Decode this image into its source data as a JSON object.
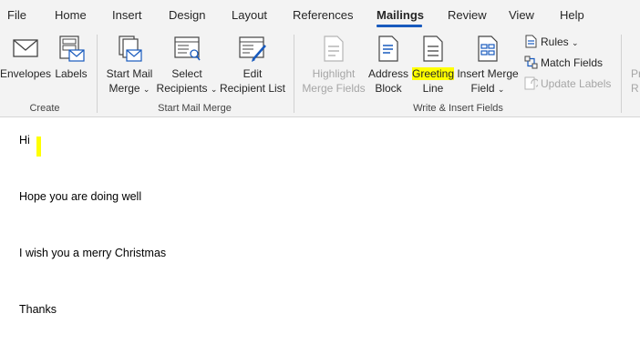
{
  "tabs": [
    "File",
    "Home",
    "Insert",
    "Design",
    "Layout",
    "References",
    "Mailings",
    "Review",
    "View",
    "Help"
  ],
  "active_tab": "Mailings",
  "ribbon": {
    "create": {
      "envelopes": "Envelopes",
      "labels": "Labels",
      "group_label": "Create"
    },
    "start_mail_merge": {
      "start_line1": "Start Mail",
      "start_line2": "Merge",
      "select_line1": "Select",
      "select_line2": "Recipients",
      "edit_line1": "Edit",
      "edit_line2": "Recipient List",
      "group_label": "Start Mail Merge"
    },
    "write_insert": {
      "highlight_line1": "Highlight",
      "highlight_line2": "Merge Fields",
      "address_line1": "Address",
      "address_line2": "Block",
      "greeting_line1": "Greeting",
      "greeting_line2": "Line",
      "insert_line1": "Insert Merge",
      "insert_line2": "Field",
      "rules": "Rules",
      "match_fields": "Match Fields",
      "update_labels": "Update Labels",
      "group_label": "Write & Insert Fields"
    },
    "preview_partial_line1": "Pr",
    "preview_partial_line2": "R"
  },
  "document": {
    "lines": [
      "Hi",
      "Hope you are doing well",
      "I wish you a merry Christmas",
      "Thanks"
    ]
  },
  "colors": {
    "accent": "#185abd",
    "highlight": "#ffff00",
    "ribbon_bg": "#f3f3f3"
  }
}
